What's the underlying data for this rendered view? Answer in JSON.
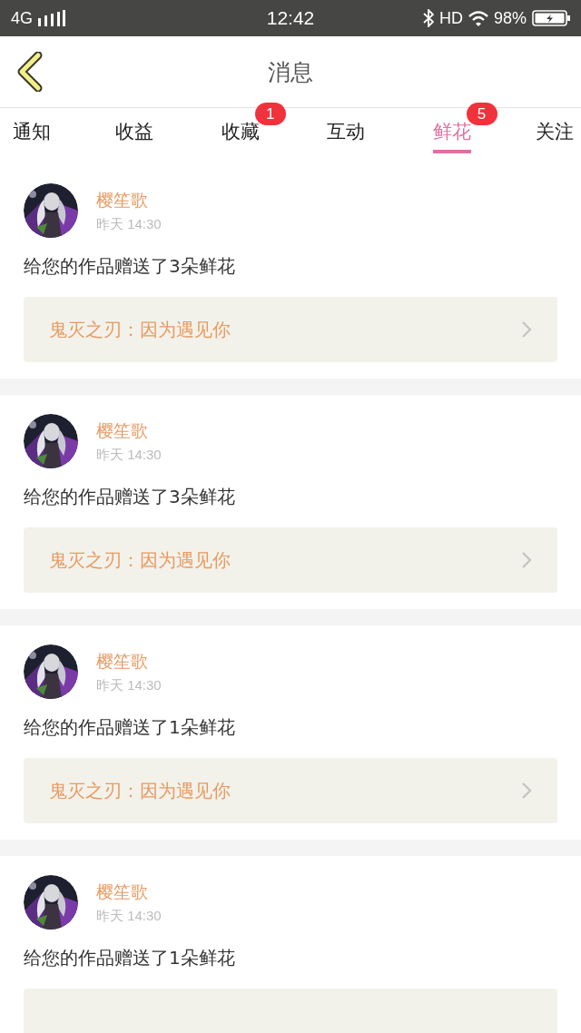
{
  "status_bar": {
    "network": "4G",
    "time": "12:42",
    "hd": "HD",
    "battery": "98%"
  },
  "header": {
    "title": "消息"
  },
  "tabs": [
    {
      "label": "通知",
      "selected": false
    },
    {
      "label": "收益",
      "selected": false
    },
    {
      "label": "收藏",
      "selected": false,
      "badge": "1"
    },
    {
      "label": "互动",
      "selected": false
    },
    {
      "label": "鲜花",
      "selected": true,
      "badge": "5"
    },
    {
      "label": "关注",
      "selected": false
    }
  ],
  "messages": [
    {
      "name": "樱笙歌",
      "time": "昨天 14:30",
      "text": "给您的作品赠送了3朵鲜花",
      "work": "鬼灭之刃：因为遇见你"
    },
    {
      "name": "樱笙歌",
      "time": "昨天 14:30",
      "text": "给您的作品赠送了3朵鲜花",
      "work": "鬼灭之刃：因为遇见你"
    },
    {
      "name": "樱笙歌",
      "time": "昨天 14:30",
      "text": "给您的作品赠送了1朵鲜花",
      "work": "鬼灭之刃：因为遇见你"
    },
    {
      "name": "樱笙歌",
      "time": "昨天 14:30",
      "text": "给您的作品赠送了1朵鲜花"
    }
  ]
}
